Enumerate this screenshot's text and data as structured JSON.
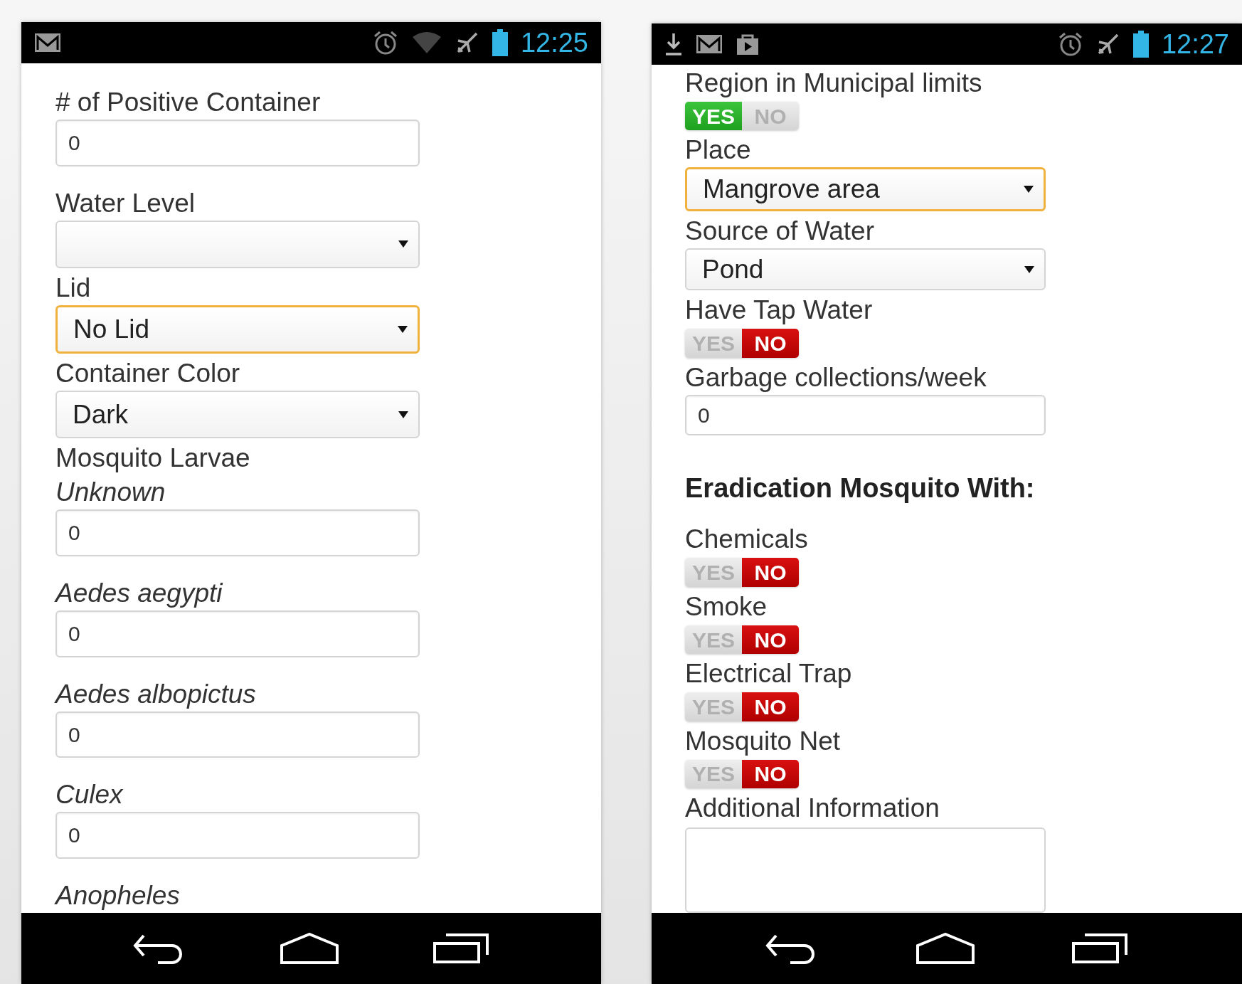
{
  "screens": [
    {
      "status_bar": {
        "time": "12:25"
      },
      "fields": [
        {
          "kind": "number",
          "label": "# of Positive Container",
          "value": "0",
          "italic": false
        },
        {
          "kind": "select",
          "label": "Water Level",
          "focused": false
        },
        {
          "kind": "select",
          "label": "Lid",
          "value": "No Lid",
          "focused": true
        },
        {
          "kind": "select",
          "label": "Container Color",
          "value": "Dark",
          "focused": false
        },
        {
          "kind": "group",
          "label": "Mosquito Larvae"
        },
        {
          "kind": "number",
          "label": "Unknown",
          "value": "0",
          "italic": true
        },
        {
          "kind": "number",
          "label": "Aedes aegypti",
          "value": "0",
          "italic": true
        },
        {
          "kind": "number",
          "label": "Aedes albopictus",
          "value": "0",
          "italic": true
        },
        {
          "kind": "number",
          "label": "Culex",
          "value": "0",
          "italic": true
        },
        {
          "kind": "group",
          "label": "Anopheles",
          "italic": true
        }
      ]
    },
    {
      "status_bar": {
        "time": "12:27"
      },
      "fields": [
        {
          "kind": "toggle",
          "label": "Region in Municipal limits",
          "yes": "YES",
          "no": "NO",
          "on": true
        },
        {
          "kind": "select",
          "label": "Place",
          "value": "Mangrove area",
          "focused": true
        },
        {
          "kind": "select",
          "label": "Source of Water",
          "value": "Pond",
          "focused": false
        },
        {
          "kind": "toggle",
          "label": "Have Tap Water",
          "yes": "YES",
          "no": "NO",
          "on": false
        },
        {
          "kind": "number",
          "label": "Garbage collections/week",
          "value": "0",
          "italic": false
        },
        {
          "kind": "heading",
          "label": "Eradication Mosquito With:"
        },
        {
          "kind": "toggle",
          "label": "Chemicals",
          "yes": "YES",
          "no": "NO",
          "on": false
        },
        {
          "kind": "toggle",
          "label": "Smoke",
          "yes": "YES",
          "no": "NO",
          "on": false
        },
        {
          "kind": "toggle",
          "label": "Electrical Trap",
          "yes": "YES",
          "no": "NO",
          "on": false
        },
        {
          "kind": "toggle",
          "label": "Mosquito Net",
          "yes": "YES",
          "no": "NO",
          "on": false
        },
        {
          "kind": "textarea",
          "label": "Additional Information"
        }
      ]
    }
  ]
}
